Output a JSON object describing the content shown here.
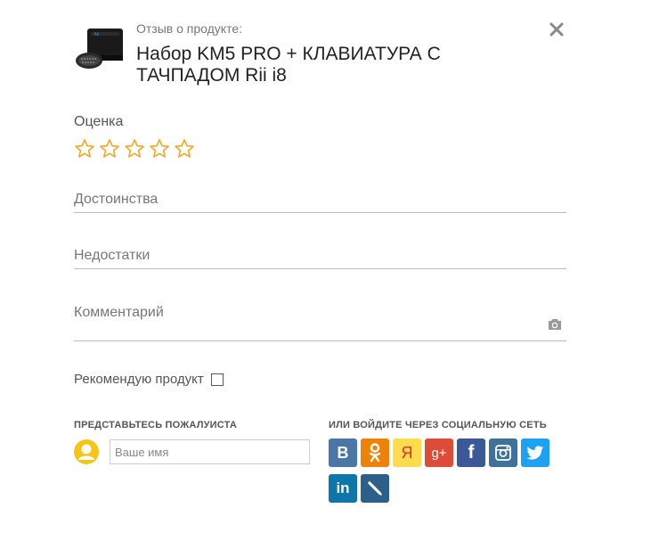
{
  "header": {
    "subtitle": "Отзыв о продукте:",
    "product_title": "Набор KM5 PRO + КЛАВИАТУРА С ТАЧПАДОМ Rii i8",
    "close_icon": "close-icon"
  },
  "rating": {
    "label": "Оценка",
    "max": 5,
    "value": 0,
    "star_color": "#f5a623"
  },
  "fields": {
    "pros_placeholder": "Достоинства",
    "cons_placeholder": "Недостатки",
    "comment_placeholder": "Комментарий",
    "camera_icon": "camera-icon"
  },
  "recommend": {
    "label": "Рекомендую продукт",
    "checked": false
  },
  "intro": {
    "heading": "ПРЕДСТАВЬТЕСЬ ПОЖАЛУИСТА",
    "name_placeholder": "Ваше имя",
    "avatar_color": "#f5c518"
  },
  "social": {
    "heading": "ИЛИ ВОЙДИТЕ ЧЕРЕЗ СОЦИАЛЬНУЮ СЕТЬ",
    "networks": [
      {
        "name": "vk",
        "glyph": "B",
        "color": "#4a76a8"
      },
      {
        "name": "odnoklassniki",
        "glyph": "ok",
        "color": "#ee8208"
      },
      {
        "name": "yandex",
        "glyph": "Я",
        "color": "#ffdb4d"
      },
      {
        "name": "google-plus",
        "glyph": "g+",
        "color": "#dd4b39"
      },
      {
        "name": "facebook",
        "glyph": "f",
        "color": "#3b5998"
      },
      {
        "name": "instagram",
        "glyph": "camera",
        "color": "#3f729b"
      },
      {
        "name": "twitter",
        "glyph": "bird",
        "color": "#1da1f2"
      },
      {
        "name": "linkedin",
        "glyph": "in",
        "color": "#0e76a8"
      },
      {
        "name": "livejournal",
        "glyph": "pencil",
        "color": "#2d5f8b"
      }
    ]
  }
}
